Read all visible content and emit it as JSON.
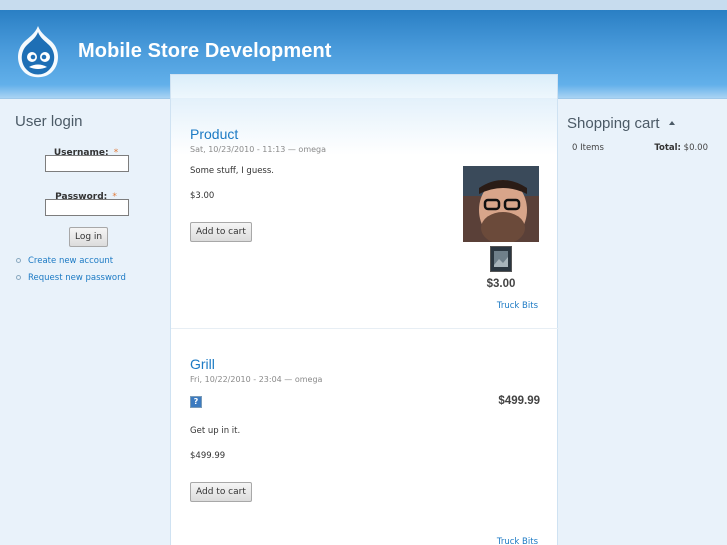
{
  "header": {
    "site_name": "Mobile Store Development",
    "background_color": "#3a8fd3"
  },
  "login": {
    "title": "User login",
    "username_label": "Username:",
    "password_label": "Password:",
    "required_mark": "*",
    "username_value": "",
    "password_value": "",
    "login_button": "Log in",
    "links": [
      "Create new account",
      "Request new password"
    ]
  },
  "nodes": [
    {
      "title": "Product",
      "meta": "Sat, 10/23/2010 - 11:13 — omega",
      "body": "Some stuff, I guess.",
      "price": "$3.00",
      "add_button": "Add to cart",
      "side_price": "$3.00",
      "link": "Truck Bits"
    },
    {
      "title": "Grill",
      "meta": "Fri, 10/22/2010 - 23:04 — omega",
      "side_price": "$499.99",
      "body": "Get up in it.",
      "price": "$499.99",
      "add_button": "Add to cart",
      "link": "Truck Bits"
    }
  ],
  "cart": {
    "title": "Shopping cart",
    "items": "0 Items",
    "total_label": "Total:",
    "total_value": "$0.00"
  },
  "colors": {
    "link": "#1c7ac4",
    "page_bg": "#e9f2fa",
    "header_dark": "#2a7fc4"
  }
}
